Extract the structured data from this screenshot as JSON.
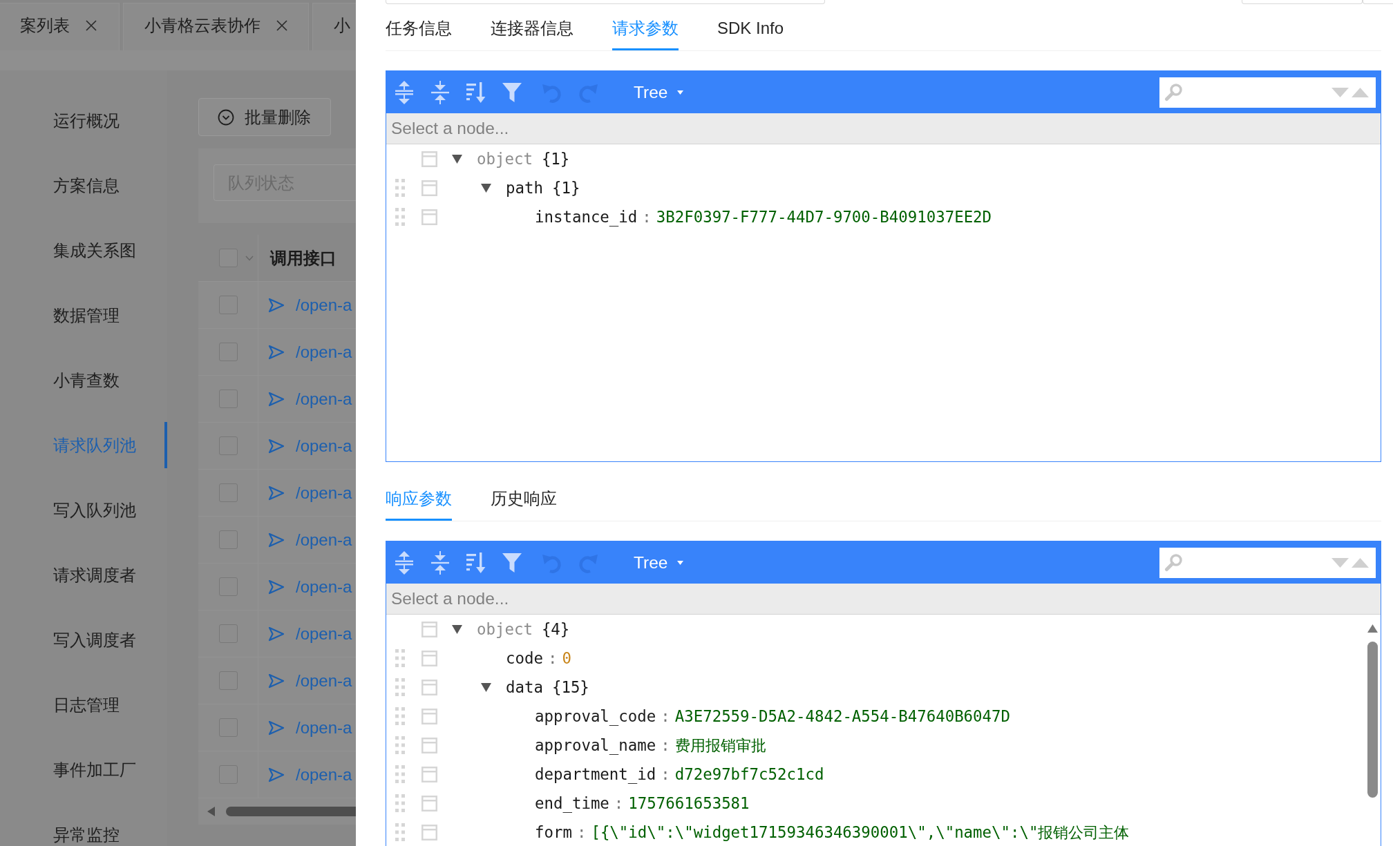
{
  "page_tabs": [
    {
      "label": "案列表",
      "closable": true,
      "selected": false
    },
    {
      "label": "小青格云表协作",
      "closable": true,
      "selected": false
    },
    {
      "label": "小",
      "closable": false,
      "selected": false
    }
  ],
  "sidebar": {
    "items": [
      {
        "label": "运行概况",
        "selected": false
      },
      {
        "label": "方案信息",
        "selected": false
      },
      {
        "label": "集成关系图",
        "selected": false
      },
      {
        "label": "数据管理",
        "selected": false
      },
      {
        "label": "小青查数",
        "selected": false
      },
      {
        "label": "请求队列池",
        "selected": true
      },
      {
        "label": "写入队列池",
        "selected": false
      },
      {
        "label": "请求调度者",
        "selected": false
      },
      {
        "label": "写入调度者",
        "selected": false
      },
      {
        "label": "日志管理",
        "selected": false
      },
      {
        "label": "事件加工厂",
        "selected": false
      },
      {
        "label": "异常监控",
        "selected": false
      }
    ]
  },
  "toolbar": {
    "buttons": [
      {
        "label": "批量删除"
      }
    ]
  },
  "filter": {
    "placeholder": "队列状态"
  },
  "table": {
    "header": {
      "checked": false,
      "columns": [
        "调用接口"
      ]
    },
    "rows": [
      {
        "checked": false,
        "cells": [
          "/open-a"
        ]
      },
      {
        "checked": false,
        "cells": [
          "/open-a"
        ]
      },
      {
        "checked": false,
        "cells": [
          "/open-a"
        ]
      },
      {
        "checked": false,
        "cells": [
          "/open-a"
        ]
      },
      {
        "checked": false,
        "cells": [
          "/open-a"
        ]
      },
      {
        "checked": false,
        "cells": [
          "/open-a"
        ]
      },
      {
        "checked": false,
        "cells": [
          "/open-a"
        ]
      },
      {
        "checked": false,
        "cells": [
          "/open-a"
        ]
      },
      {
        "checked": false,
        "cells": [
          "/open-a"
        ]
      },
      {
        "checked": false,
        "cells": [
          "/open-a"
        ]
      },
      {
        "checked": false,
        "cells": [
          "/open-a"
        ]
      }
    ]
  },
  "drawer": {
    "tabs": [
      {
        "label": "任务信息",
        "selected": false
      },
      {
        "label": "连接器信息",
        "selected": false
      },
      {
        "label": "请求参数",
        "selected": true
      },
      {
        "label": "SDK Info",
        "selected": false
      }
    ],
    "request_editor": {
      "toolbar": {
        "buttons": [
          {
            "kind": "expand",
            "disabled": false
          },
          {
            "kind": "collapse",
            "disabled": false
          },
          {
            "kind": "sort",
            "disabled": false
          },
          {
            "kind": "filter",
            "disabled": false
          },
          {
            "kind": "undo",
            "disabled": true
          },
          {
            "kind": "redo",
            "disabled": true
          }
        ],
        "mode": "Tree"
      },
      "navigation": "Select a node...",
      "tree": [
        {
          "field": "object",
          "kind": "object",
          "count": "{1}",
          "expanded": true,
          "children": [
            {
              "field": "path",
              "kind": "object",
              "count": "{1}",
              "expanded": true,
              "children": [
                {
                  "field": "instance_id",
                  "kind": "string",
                  "separator": ":",
                  "value": "3B2F0397-F777-44D7-9700-B4091037EE2D"
                }
              ]
            }
          ]
        }
      ]
    },
    "response_tabs": [
      {
        "label": "响应参数",
        "selected": true
      },
      {
        "label": "历史响应",
        "selected": false
      }
    ],
    "response_editor": {
      "toolbar": {
        "buttons": [
          {
            "kind": "expand",
            "disabled": false
          },
          {
            "kind": "collapse",
            "disabled": false
          },
          {
            "kind": "sort",
            "disabled": false
          },
          {
            "kind": "filter",
            "disabled": false
          },
          {
            "kind": "undo",
            "disabled": true
          },
          {
            "kind": "redo",
            "disabled": true
          }
        ],
        "mode": "Tree"
      },
      "navigation": "Select a node...",
      "tree": [
        {
          "field": "object",
          "kind": "object",
          "count": "{4}",
          "expanded": true,
          "children": [
            {
              "field": "code",
              "kind": "number",
              "separator": ":",
              "value": "0"
            },
            {
              "field": "data",
              "kind": "object",
              "count": "{15}",
              "expanded": true,
              "children": [
                {
                  "field": "approval_code",
                  "kind": "string",
                  "separator": ":",
                  "value": "A3E72559-D5A2-4842-A554-B47640B6047D"
                },
                {
                  "field": "approval_name",
                  "kind": "string",
                  "separator": ":",
                  "value": "费用报销审批"
                },
                {
                  "field": "department_id",
                  "kind": "string",
                  "separator": ":",
                  "value": "d72e97bf7c52c1cd"
                },
                {
                  "field": "end_time",
                  "kind": "string",
                  "separator": ":",
                  "value": "1757661653581"
                },
                {
                  "field": "form",
                  "kind": "string",
                  "separator": ":",
                  "value": "[{\\\"id\\\":\\\"widget17159346346390001\\\",\\\"name\\\":\\\"报销公司主体"
                }
              ]
            }
          ]
        }
      ]
    }
  }
}
